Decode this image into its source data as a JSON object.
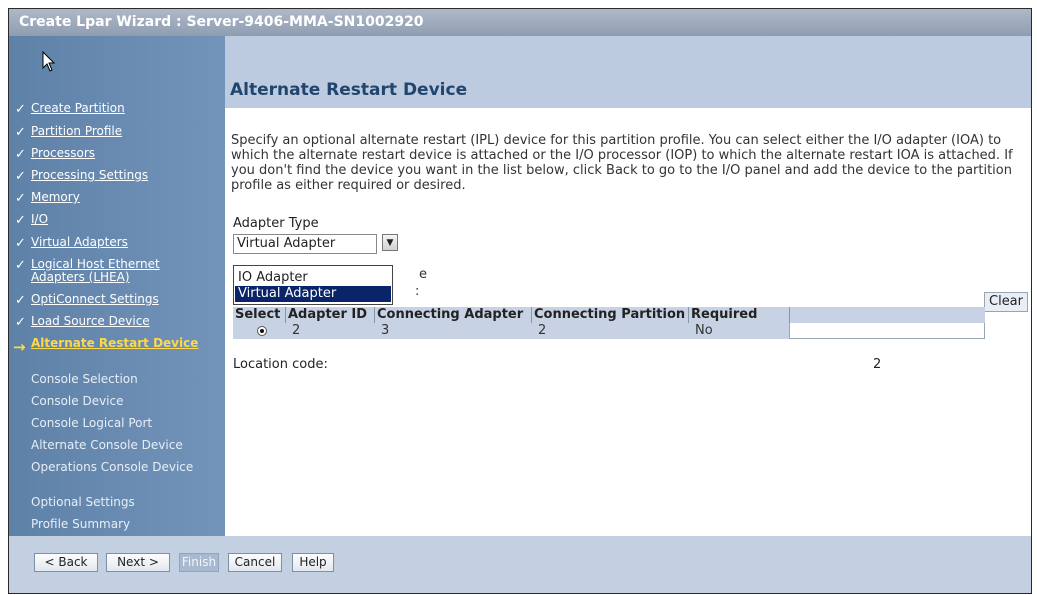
{
  "window": {
    "title": "Create Lpar Wizard : Server-9406-MMA-SN1002920"
  },
  "sidebar": {
    "items": [
      {
        "label": "Create Partition",
        "state": "done"
      },
      {
        "label": "Partition Profile",
        "state": "done"
      },
      {
        "label": "Processors",
        "state": "done"
      },
      {
        "label": "Processing Settings",
        "state": "done"
      },
      {
        "label": "Memory",
        "state": "done"
      },
      {
        "label": "I/O",
        "state": "done"
      },
      {
        "label": "Virtual Adapters",
        "state": "done"
      },
      {
        "label": "Logical Host Ethernet Adapters (LHEA)",
        "state": "done"
      },
      {
        "label": "OptiConnect Settings",
        "state": "done"
      },
      {
        "label": "Load Source Device",
        "state": "done"
      },
      {
        "label": "Alternate Restart Device",
        "state": "current"
      },
      {
        "label": "Console Selection",
        "state": "todo"
      },
      {
        "label": "Console Device",
        "state": "todo"
      },
      {
        "label": "Console Logical Port",
        "state": "todo"
      },
      {
        "label": "Alternate Console Device",
        "state": "todo"
      },
      {
        "label": "Operations Console Device",
        "state": "todo"
      },
      {
        "label": "Optional Settings",
        "state": "todo"
      },
      {
        "label": "Profile Summary",
        "state": "todo"
      }
    ],
    "check_glyph": "✓",
    "arrow_glyph": "→"
  },
  "main": {
    "heading": "Alternate Restart Device",
    "instructions": "Specify an optional alternate restart (IPL) device for this partition profile. You can select either the I/O adapter (IOA) to which the alternate restart device is attached or the I/O processor (IOP) to which the alternate restart IOA is attached. If you don't find the device you want in the list below, click Back to go to the I/O panel and add the device to the partition profile as either required or desired.",
    "adapter_type_label": "Adapter Type",
    "adapter_type_value": "Virtual Adapter",
    "dropdown_options": [
      "IO Adapter",
      "Virtual Adapter"
    ],
    "obscured_text_1": "e",
    "obscured_text_2": ":",
    "clear_label": "Clear",
    "table": {
      "headers": [
        "Select",
        "Adapter ID",
        "Connecting Adapter",
        "Connecting Partition",
        "Required"
      ],
      "rows": [
        {
          "adapter_id": "2",
          "connecting_adapter": "3",
          "connecting_partition": "2",
          "required": "No"
        }
      ]
    },
    "location_label": "Location code:",
    "location_value": "2"
  },
  "footer": {
    "back": "< Back",
    "next": "Next >",
    "finish": "Finish",
    "cancel": "Cancel",
    "help": "Help"
  },
  "colors": {
    "sidebar": "#6a8cb3",
    "current_step": "#fcd94c",
    "header_band": "#bccbe0",
    "selection": "#0a246a"
  }
}
